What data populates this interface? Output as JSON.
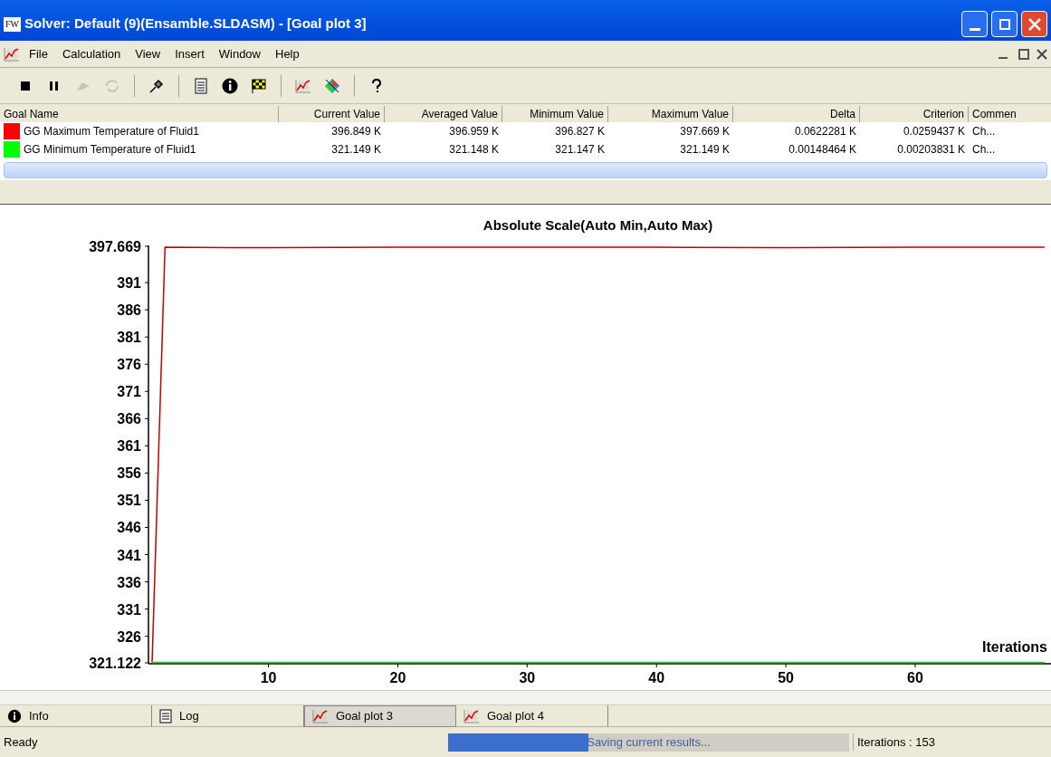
{
  "window": {
    "title": "Solver: Default (9)(Ensamble.SLDASM) - [Goal plot 3]",
    "app_icon": "FW"
  },
  "menu": [
    "File",
    "Calculation",
    "View",
    "Insert",
    "Window",
    "Help"
  ],
  "toolbar": [
    {
      "kind": "stop",
      "disabled": false
    },
    {
      "kind": "pause",
      "disabled": false
    },
    {
      "kind": "arrow",
      "disabled": true
    },
    {
      "kind": "refresh",
      "disabled": true
    },
    {
      "kind": "sep"
    },
    {
      "kind": "pin",
      "disabled": false
    },
    {
      "kind": "sep"
    },
    {
      "kind": "document",
      "disabled": false
    },
    {
      "kind": "info",
      "disabled": false
    },
    {
      "kind": "flag",
      "disabled": false
    },
    {
      "kind": "sep"
    },
    {
      "kind": "chart",
      "disabled": false
    },
    {
      "kind": "diamond",
      "disabled": false
    },
    {
      "kind": "sep"
    },
    {
      "kind": "help",
      "disabled": false
    }
  ],
  "table": {
    "columns": [
      "Goal Name",
      "Current Value",
      "Averaged Value",
      "Minimum Value",
      "Maximum Value",
      "Delta",
      "Criterion",
      "Commen"
    ],
    "rows": [
      {
        "color": "#ff0000",
        "cells": [
          "GG Maximum Temperature of Fluid1",
          "396.849 K",
          "396.959 K",
          "396.827 K",
          "397.669 K",
          "0.0622281 K",
          "0.0259437 K",
          "Ch..."
        ]
      },
      {
        "color": "#00ff00",
        "cells": [
          "GG Minimum Temperature of Fluid1",
          "321.149 K",
          "321.148 K",
          "321.147 K",
          "321.149 K",
          "0.00148464 K",
          "0.00203831 K",
          "Ch..."
        ]
      }
    ]
  },
  "plot": {
    "chart_data": {
      "type": "line",
      "title": "Absolute Scale(Auto Min,Auto Max)",
      "xlabel": "Iterations",
      "x": [
        1,
        2,
        10,
        20,
        30,
        40,
        50,
        60,
        70
      ],
      "xlim": [
        1,
        70.5
      ],
      "ylim": [
        321.122,
        397.669
      ],
      "xticks": [
        10,
        20,
        30,
        40,
        50,
        60
      ],
      "yticks": [
        {
          "value": 321.122,
          "label": "321.122"
        },
        326,
        331,
        336,
        341,
        346,
        351,
        356,
        361,
        366,
        371,
        376,
        381,
        386,
        391,
        {
          "value": 397.669,
          "label": "397.669"
        }
      ],
      "series": [
        {
          "color": "#c00000",
          "values": [
            321.2,
            397.5,
            397.4,
            397.5,
            397.5,
            397.5,
            397.4,
            397.5,
            397.5
          ]
        },
        {
          "color": "#40c040",
          "values": [
            321.2,
            321.2,
            321.2,
            321.2,
            321.2,
            321.2,
            321.2,
            321.2,
            321.2
          ]
        }
      ]
    }
  },
  "tabs": [
    {
      "label": "Info",
      "kind": "info",
      "selected": false
    },
    {
      "label": "Log",
      "kind": "document",
      "selected": false
    },
    {
      "label": "Goal plot 3",
      "kind": "chart",
      "selected": true
    },
    {
      "label": "Goal plot 4",
      "kind": "chart",
      "selected": false
    }
  ],
  "status": {
    "text": "Ready",
    "progress": {
      "level": 0.35,
      "text": "Saving current results..."
    },
    "iterations": "Iterations : 153"
  }
}
